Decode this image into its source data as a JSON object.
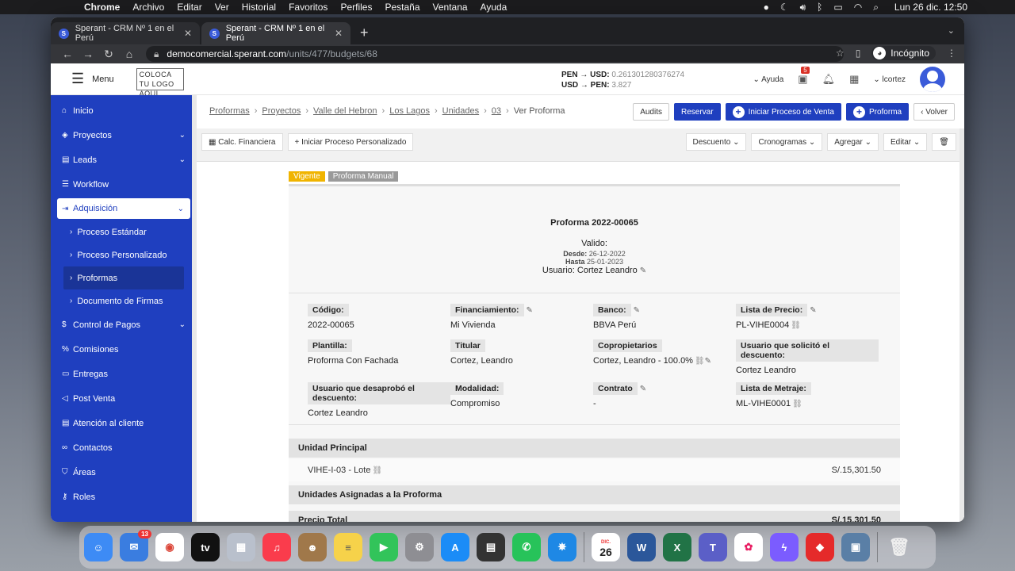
{
  "menubar": {
    "app": "Chrome",
    "items": [
      "Archivo",
      "Editar",
      "Ver",
      "Historial",
      "Favoritos",
      "Perfiles",
      "Pestaña",
      "Ventana",
      "Ayuda"
    ],
    "clock": "Lun 26 dic.  12:50"
  },
  "browser": {
    "tabs": [
      {
        "title": "Sperant - CRM Nº 1 en el Perú"
      },
      {
        "title": "Sperant - CRM Nº 1 en el Perú"
      }
    ],
    "url_host": "democomercial.sperant.com",
    "url_path": "/units/477/budgets/68",
    "incognito_label": "Incógnito"
  },
  "header": {
    "menu_label": "Menu",
    "logo_text": "COLOCA TU LOGO AQUI",
    "fx_line1_label": "PEN → USD:",
    "fx_line1_value": "0.261301280376274",
    "fx_line2_label": "USD → PEN:",
    "fx_line2_value": "3.827",
    "help_label": "Ayuda",
    "notif_count": "5",
    "user": "lcortez"
  },
  "sidebar": {
    "items": [
      {
        "label": "Inicio",
        "icon": "home-icon"
      },
      {
        "label": "Proyectos",
        "icon": "cube-icon"
      },
      {
        "label": "Leads",
        "icon": "briefcase-icon"
      },
      {
        "label": "Workflow",
        "icon": "list-icon"
      },
      {
        "label": "Adquisición",
        "icon": "login-icon"
      },
      {
        "label": "Control de Pagos",
        "icon": "dollar-icon"
      },
      {
        "label": "Comisiones",
        "icon": "percent-icon"
      },
      {
        "label": "Entregas",
        "icon": "truck-icon"
      },
      {
        "label": "Post Venta",
        "icon": "bullhorn-icon"
      },
      {
        "label": "Atención al cliente",
        "icon": "clipboard-icon"
      },
      {
        "label": "Contactos",
        "icon": "contacts-icon"
      },
      {
        "label": "Áreas",
        "icon": "shield-icon"
      },
      {
        "label": "Roles",
        "icon": "key-icon"
      }
    ],
    "subitems": [
      "Proceso Estándar",
      "Proceso Personalizado",
      "Proformas",
      "Documento de Firmas"
    ]
  },
  "breadcrumb": {
    "links": [
      "Proformas",
      "Proyectos",
      "Valle del Hebron",
      "Los Lagos",
      "Unidades",
      "03"
    ],
    "current": "Ver Proforma"
  },
  "actions": {
    "audits": "Audits",
    "reservar": "Reservar",
    "iniciar_venta": "Iniciar Proceso de Venta",
    "proforma": "Proforma",
    "volver": "Volver"
  },
  "subbar": {
    "calc": "Calc. Financiera",
    "iniciar_personalizado": "Iniciar Proceso Personalizado",
    "descuento": "Descuento",
    "cronogramas": "Cronogramas",
    "agregar": "Agregar",
    "editar": "Editar"
  },
  "tags": {
    "status": "Vigente",
    "type": "Proforma Manual"
  },
  "proforma": {
    "title": "Proforma 2022-00065",
    "valido_label": "Valido:",
    "desde_label": "Desde:",
    "desde": "26-12-2022",
    "hasta_label": "Hasta",
    "hasta": "25-01-2023",
    "usuario_line": "Usuario: Cortez Leandro"
  },
  "fields": {
    "codigo": {
      "label": "Código:",
      "value": "2022-00065"
    },
    "financiamiento": {
      "label": "Financiamiento:",
      "value": "Mi Vivienda"
    },
    "banco": {
      "label": "Banco:",
      "value": "BBVA Perú"
    },
    "lista_precio": {
      "label": "Lista de Precio:",
      "value": "PL-VIHE0004"
    },
    "plantilla": {
      "label": "Plantilla:",
      "value": "Proforma Con Fachada"
    },
    "titular": {
      "label": "Titular",
      "value": "Cortez, Leandro"
    },
    "copropietarios": {
      "label": "Copropietarios",
      "value": "Cortez, Leandro - 100.0%"
    },
    "usuario_solicito": {
      "label": "Usuario que solicitó el descuento:",
      "value": "Cortez Leandro"
    },
    "usuario_desaprobo": {
      "label": "Usuario que desaprobó el descuento:",
      "value": "Cortez Leandro"
    },
    "modalidad": {
      "label": "Modalidad:",
      "value": "Compromiso"
    },
    "contrato": {
      "label": "Contrato",
      "value": "-"
    },
    "lista_metraje": {
      "label": "Lista de Metraje:",
      "value": "ML-VIHE0001"
    }
  },
  "sections": {
    "unidad_principal": "Unidad Principal",
    "unit_name": "VIHE-I-03 - Lote",
    "unit_price": "S/.15,301.50",
    "unidades_asignadas": "Unidades Asignadas a la Proforma",
    "precio_total": "Precio Total",
    "precio_total_value": "S/.15,301.50"
  },
  "dock": {
    "mail_badge": "13",
    "calendar_month": "DIC.",
    "calendar_day": "26"
  }
}
